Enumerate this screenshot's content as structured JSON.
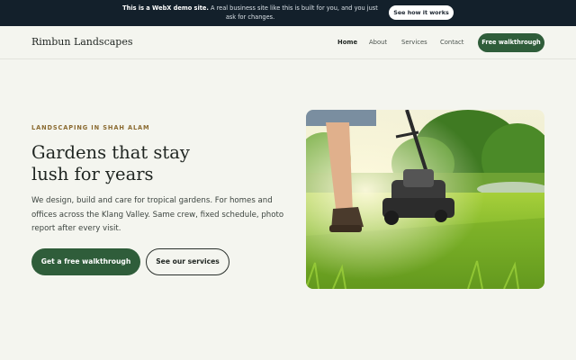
{
  "banner": {
    "strong": "This is a WebX demo site.",
    "text": " A real business site like this is built for you, and you just ask for changes.",
    "button": "See how it works"
  },
  "nav": {
    "brand": "Rimbun Landscapes",
    "links": [
      {
        "label": "Home",
        "active": true
      },
      {
        "label": "About",
        "active": false
      },
      {
        "label": "Services",
        "active": false
      },
      {
        "label": "Contact",
        "active": false
      }
    ],
    "cta": "Free walkthrough"
  },
  "hero": {
    "eyebrow": "LANDSCAPING IN SHAH ALAM",
    "headline_line1": "Gardens that stay",
    "headline_line2": "lush for years",
    "description": "We design, build and care for tropical gardens. For homes and offices across the Klang Valley. Same crew, fixed schedule, photo report after every visit.",
    "primary_button": "Get a free walkthrough",
    "secondary_button": "See our services",
    "image": "lawn-mower-on-grass-photo"
  },
  "colors": {
    "banner_bg": "#13202b",
    "page_bg": "#f4f5ef",
    "brand_green": "#2f5d3a",
    "eyebrow_gold": "#8a6a30"
  }
}
